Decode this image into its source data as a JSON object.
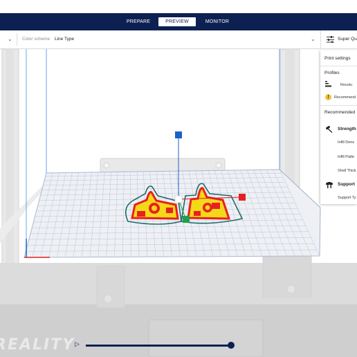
{
  "stages": {
    "prepare": "PREPARE",
    "preview": "PREVIEW",
    "monitor": "MONITOR",
    "active": "PREVIEW"
  },
  "toolbar": {
    "color_scheme_label": "Color scheme",
    "color_scheme_value": "Line Type",
    "print_settings_button": "Super Qu"
  },
  "print_panel": {
    "title": "Print settings",
    "profiles_label": "Profiles",
    "resolution_label": "Resolu",
    "recommended_notice": "Recommend",
    "recommended_header": "Recommended",
    "strength_label": "Strength",
    "infill_density": "Infill Dens",
    "infill_pattern": "Infill Patte",
    "shell_thickness": "Shell Thick",
    "support_label": "Support",
    "support_type": "Support Ty"
  },
  "brand_watermark": "REALITY",
  "colors": {
    "header_navy": "#0d2052",
    "build_plate": "#eef0f4",
    "grid_line": "#b9c3d6",
    "outer_wall": "#e8211c",
    "infill_yellow": "#f4d81a",
    "skirt_teal": "#1f6a6a",
    "gizmo_blue": "#1862c9",
    "gizmo_red": "#e32020",
    "gizmo_green": "#1fa04a"
  },
  "icons": {
    "play": "play-icon",
    "settings": "sliders-icon",
    "warning": "warning-icon",
    "strength": "hammer-icon",
    "support": "support-icon"
  }
}
